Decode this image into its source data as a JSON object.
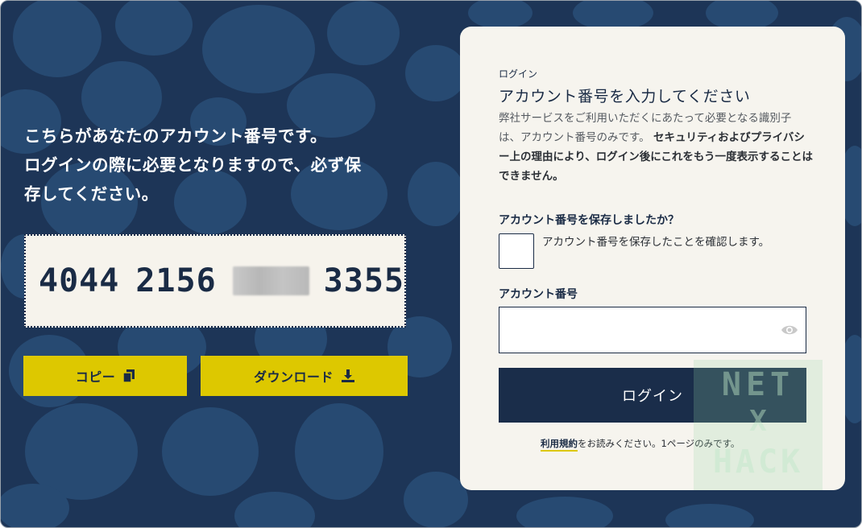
{
  "left": {
    "message_lines": [
      "こちらがあなたのアカウント番号です。",
      "ログインの際に必要となりますので、必ず保",
      "存してください。"
    ],
    "account_number": {
      "group1": "4044",
      "group2": "2156",
      "group4": "3355"
    },
    "copy_button": {
      "label": "コピー",
      "icon": "copy-icon"
    },
    "download_button": {
      "label": "ダウンロード",
      "icon": "download-icon"
    }
  },
  "card": {
    "eyebrow": "ログイン",
    "title": "アカウント番号を入力してください",
    "description_plain": "弊社サービスをご利用いただくにあたって必要となる識別子は、アカウント番号のみです。",
    "description_bold": "セキュリティおよびプライバシー上の理由により、ログイン後にこれをもう一度表示することはできません。",
    "saved_question": "アカウント番号を保存しましたか？",
    "saved_checkbox_label": "アカウント番号を保存したことを確認します。",
    "account_label": "アカウント番号",
    "account_input_value": "",
    "login_button": "ログイン",
    "footer_link": "利用規約",
    "footer_text": "をお読みください。1ページのみです。"
  },
  "watermark": {
    "line1": "NET",
    "line2": "X",
    "line3": "HACK"
  },
  "colors": {
    "background": "#1d3557",
    "blob": "#274a72",
    "accent_yellow": "#ddc800",
    "card_bg": "#f6f4ee",
    "primary_navy": "#1a2d4a"
  }
}
